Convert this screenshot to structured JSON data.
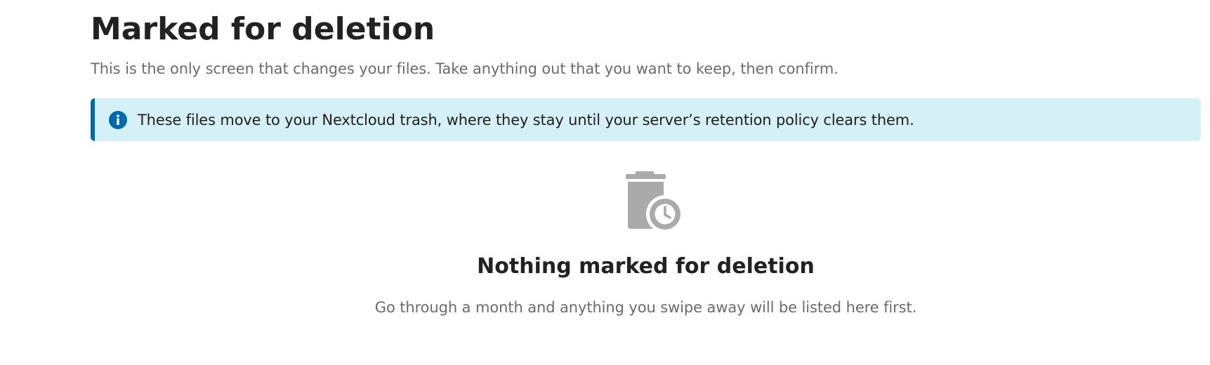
{
  "header": {
    "title": "Marked for deletion",
    "subtitle": "This is the only screen that changes your files. Take anything out that you want to keep, then confirm."
  },
  "banner": {
    "icon": "info-icon",
    "text": "These files move to your Nextcloud trash, where they stay until your server’s retention policy clears them.",
    "accent_color": "#0068ad",
    "background_color": "#d6f0f8"
  },
  "empty_state": {
    "icon": "trash-clock-icon",
    "title": "Nothing marked for deletion",
    "hint": "Go through a month and anything you swipe away will be listed here first."
  }
}
